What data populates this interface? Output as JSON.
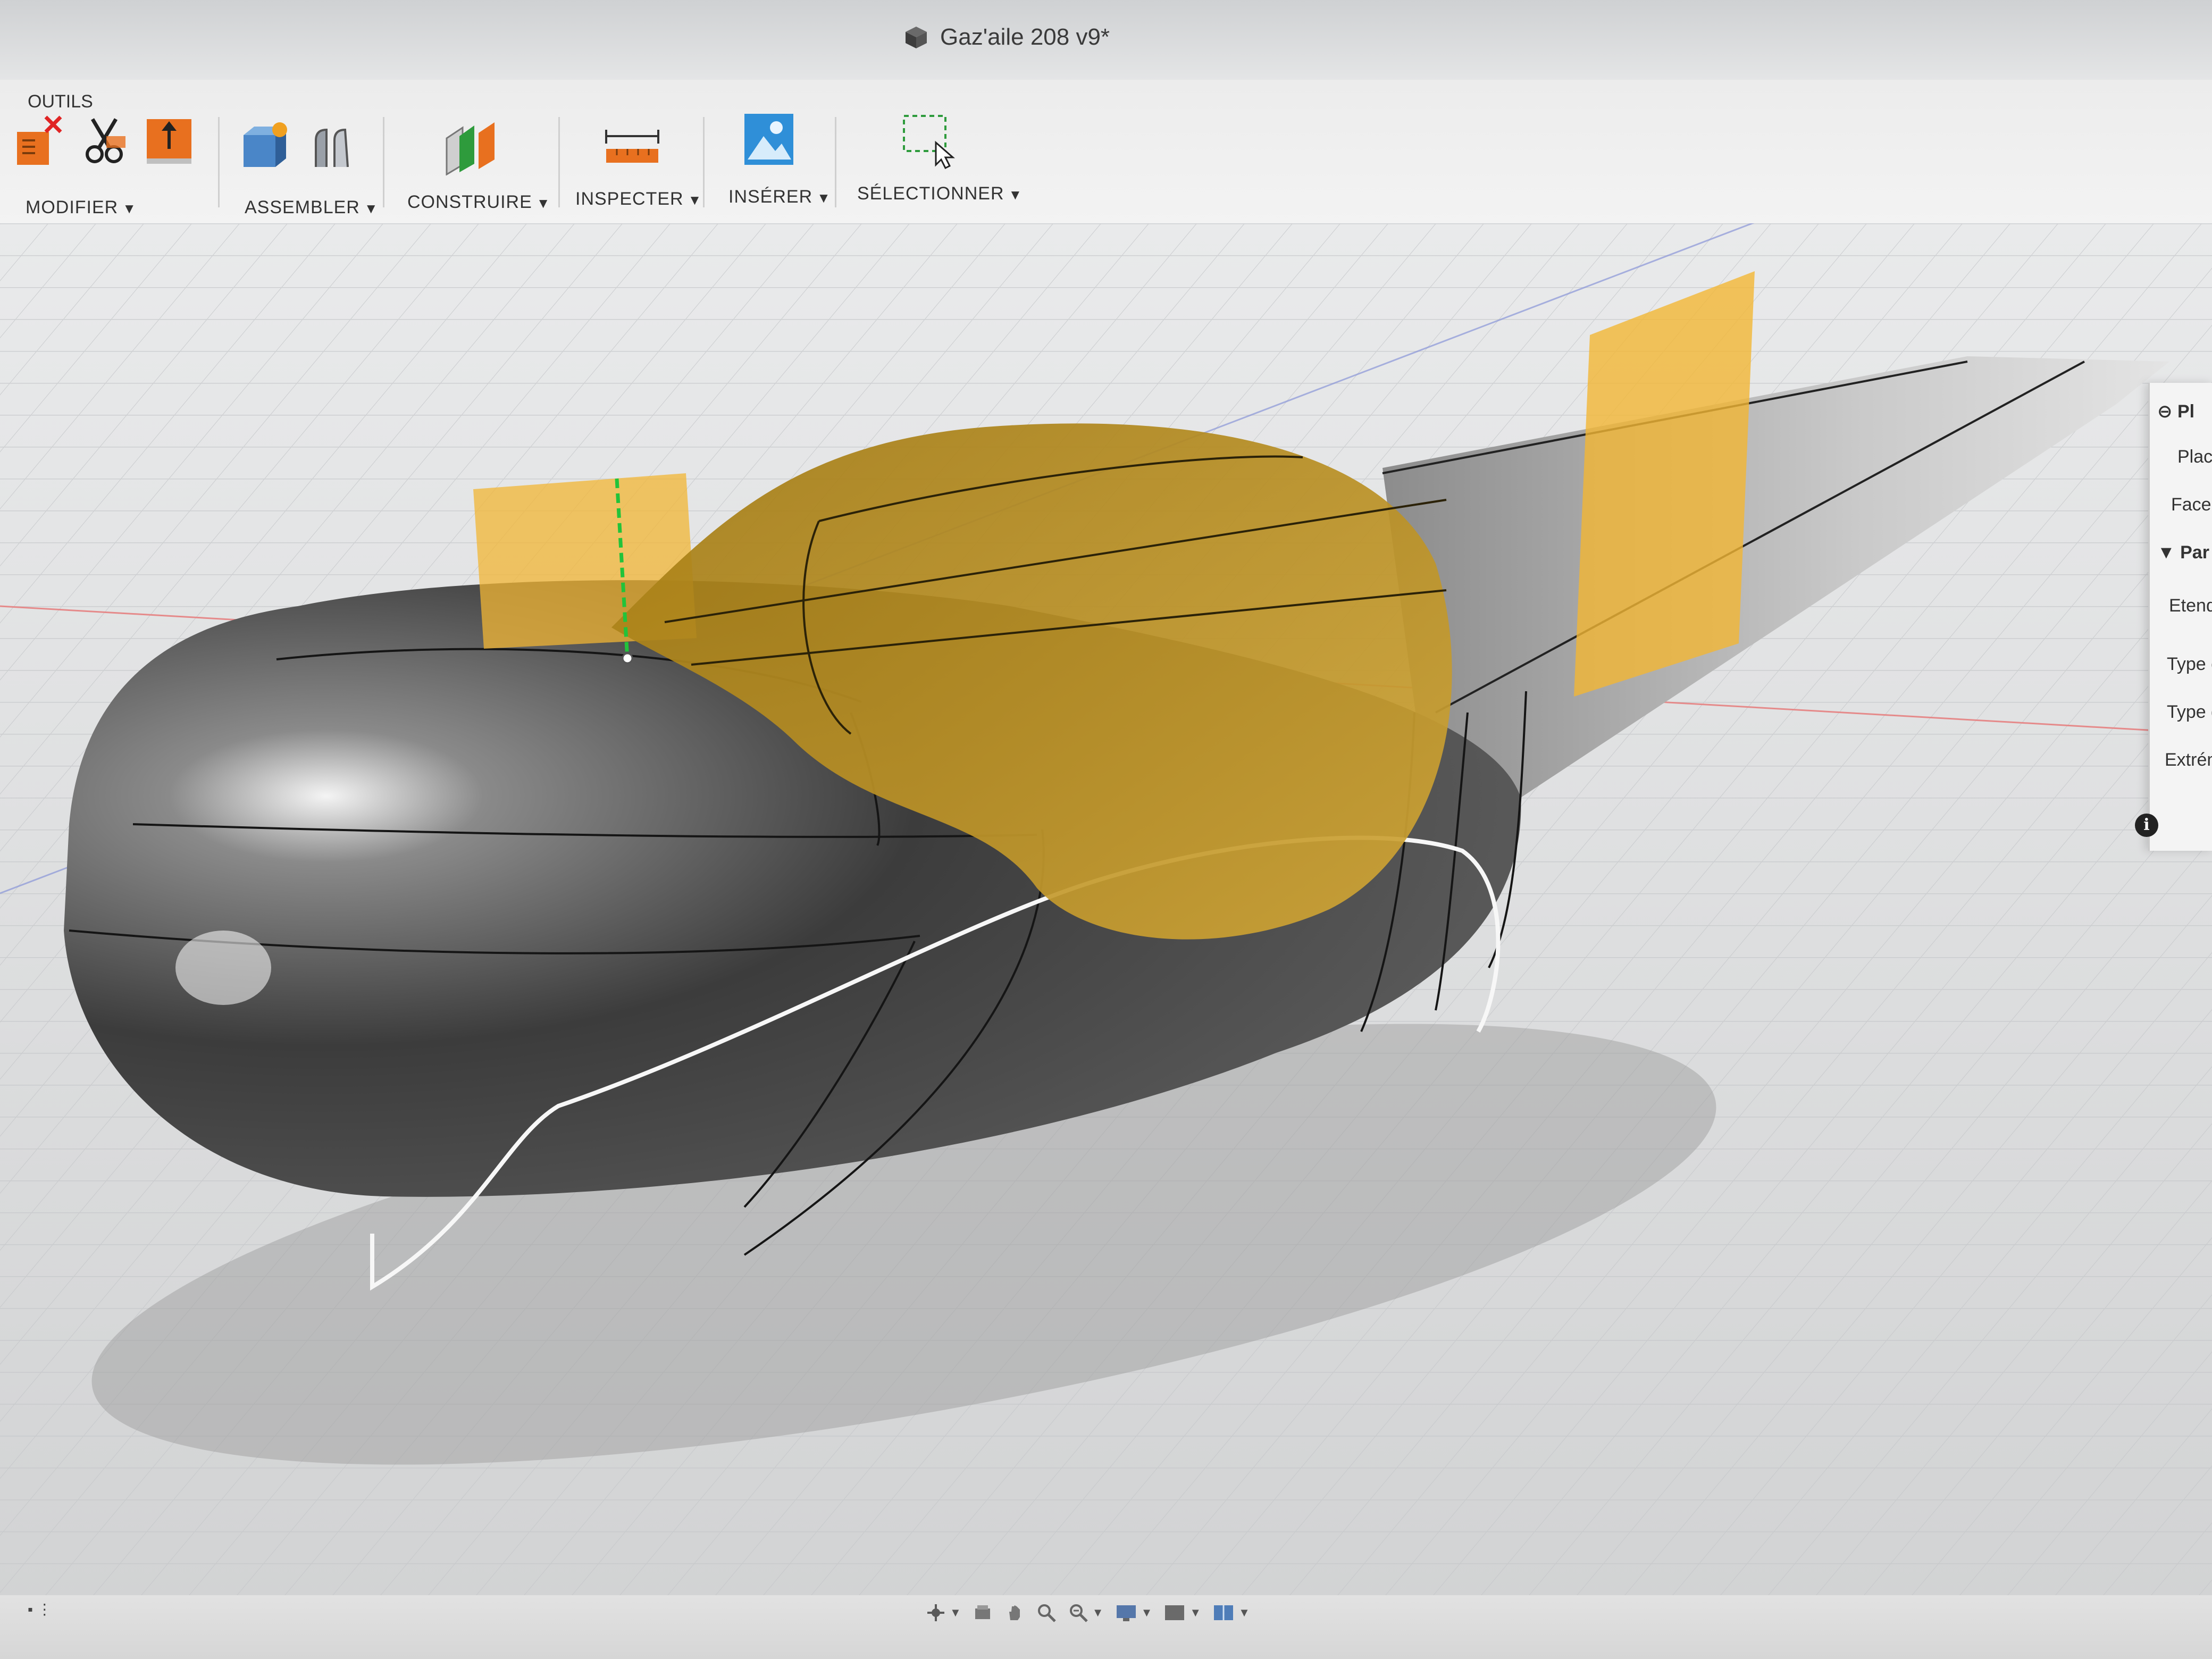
{
  "window": {
    "title": "Gaz'aile 208 v9*"
  },
  "toolbar": {
    "tools_label": "OUTILS",
    "groups": [
      {
        "label": "MODIFIER"
      },
      {
        "label": "ASSEMBLER"
      },
      {
        "label": "CONSTRUIRE"
      },
      {
        "label": "INSPECTER"
      },
      {
        "label": "INSÉRER"
      },
      {
        "label": "SÉLECTIONNER"
      }
    ],
    "dropdown_glyph": "▼"
  },
  "panel": {
    "header": "Pl",
    "rows": [
      "Plac",
      "Face,",
      "Par",
      "Etend",
      "Type c",
      "Type d",
      "Extrém"
    ],
    "info_glyph": "i"
  },
  "colors": {
    "accent_orange": "#e8701f",
    "plane_yellow": "#f2b634",
    "body_dark": "#3a3a3a",
    "canopy_gold": "#b58c1e"
  },
  "icons": {
    "modifier": [
      "delete-icon",
      "split-icon",
      "press-pull-icon"
    ],
    "assembler": [
      "new-component-icon",
      "joint-icon"
    ],
    "construire": [
      "offset-plane-icon"
    ],
    "inspecter": [
      "measure-icon"
    ],
    "inserer": [
      "insert-image-icon"
    ],
    "selectionner": [
      "window-select-icon"
    ],
    "navigation": [
      "orbit-icon",
      "look-at-icon",
      "pan-icon",
      "zoom-icon",
      "fit-icon",
      "display-settings-icon",
      "visual-style-icon",
      "viewports-icon"
    ]
  }
}
